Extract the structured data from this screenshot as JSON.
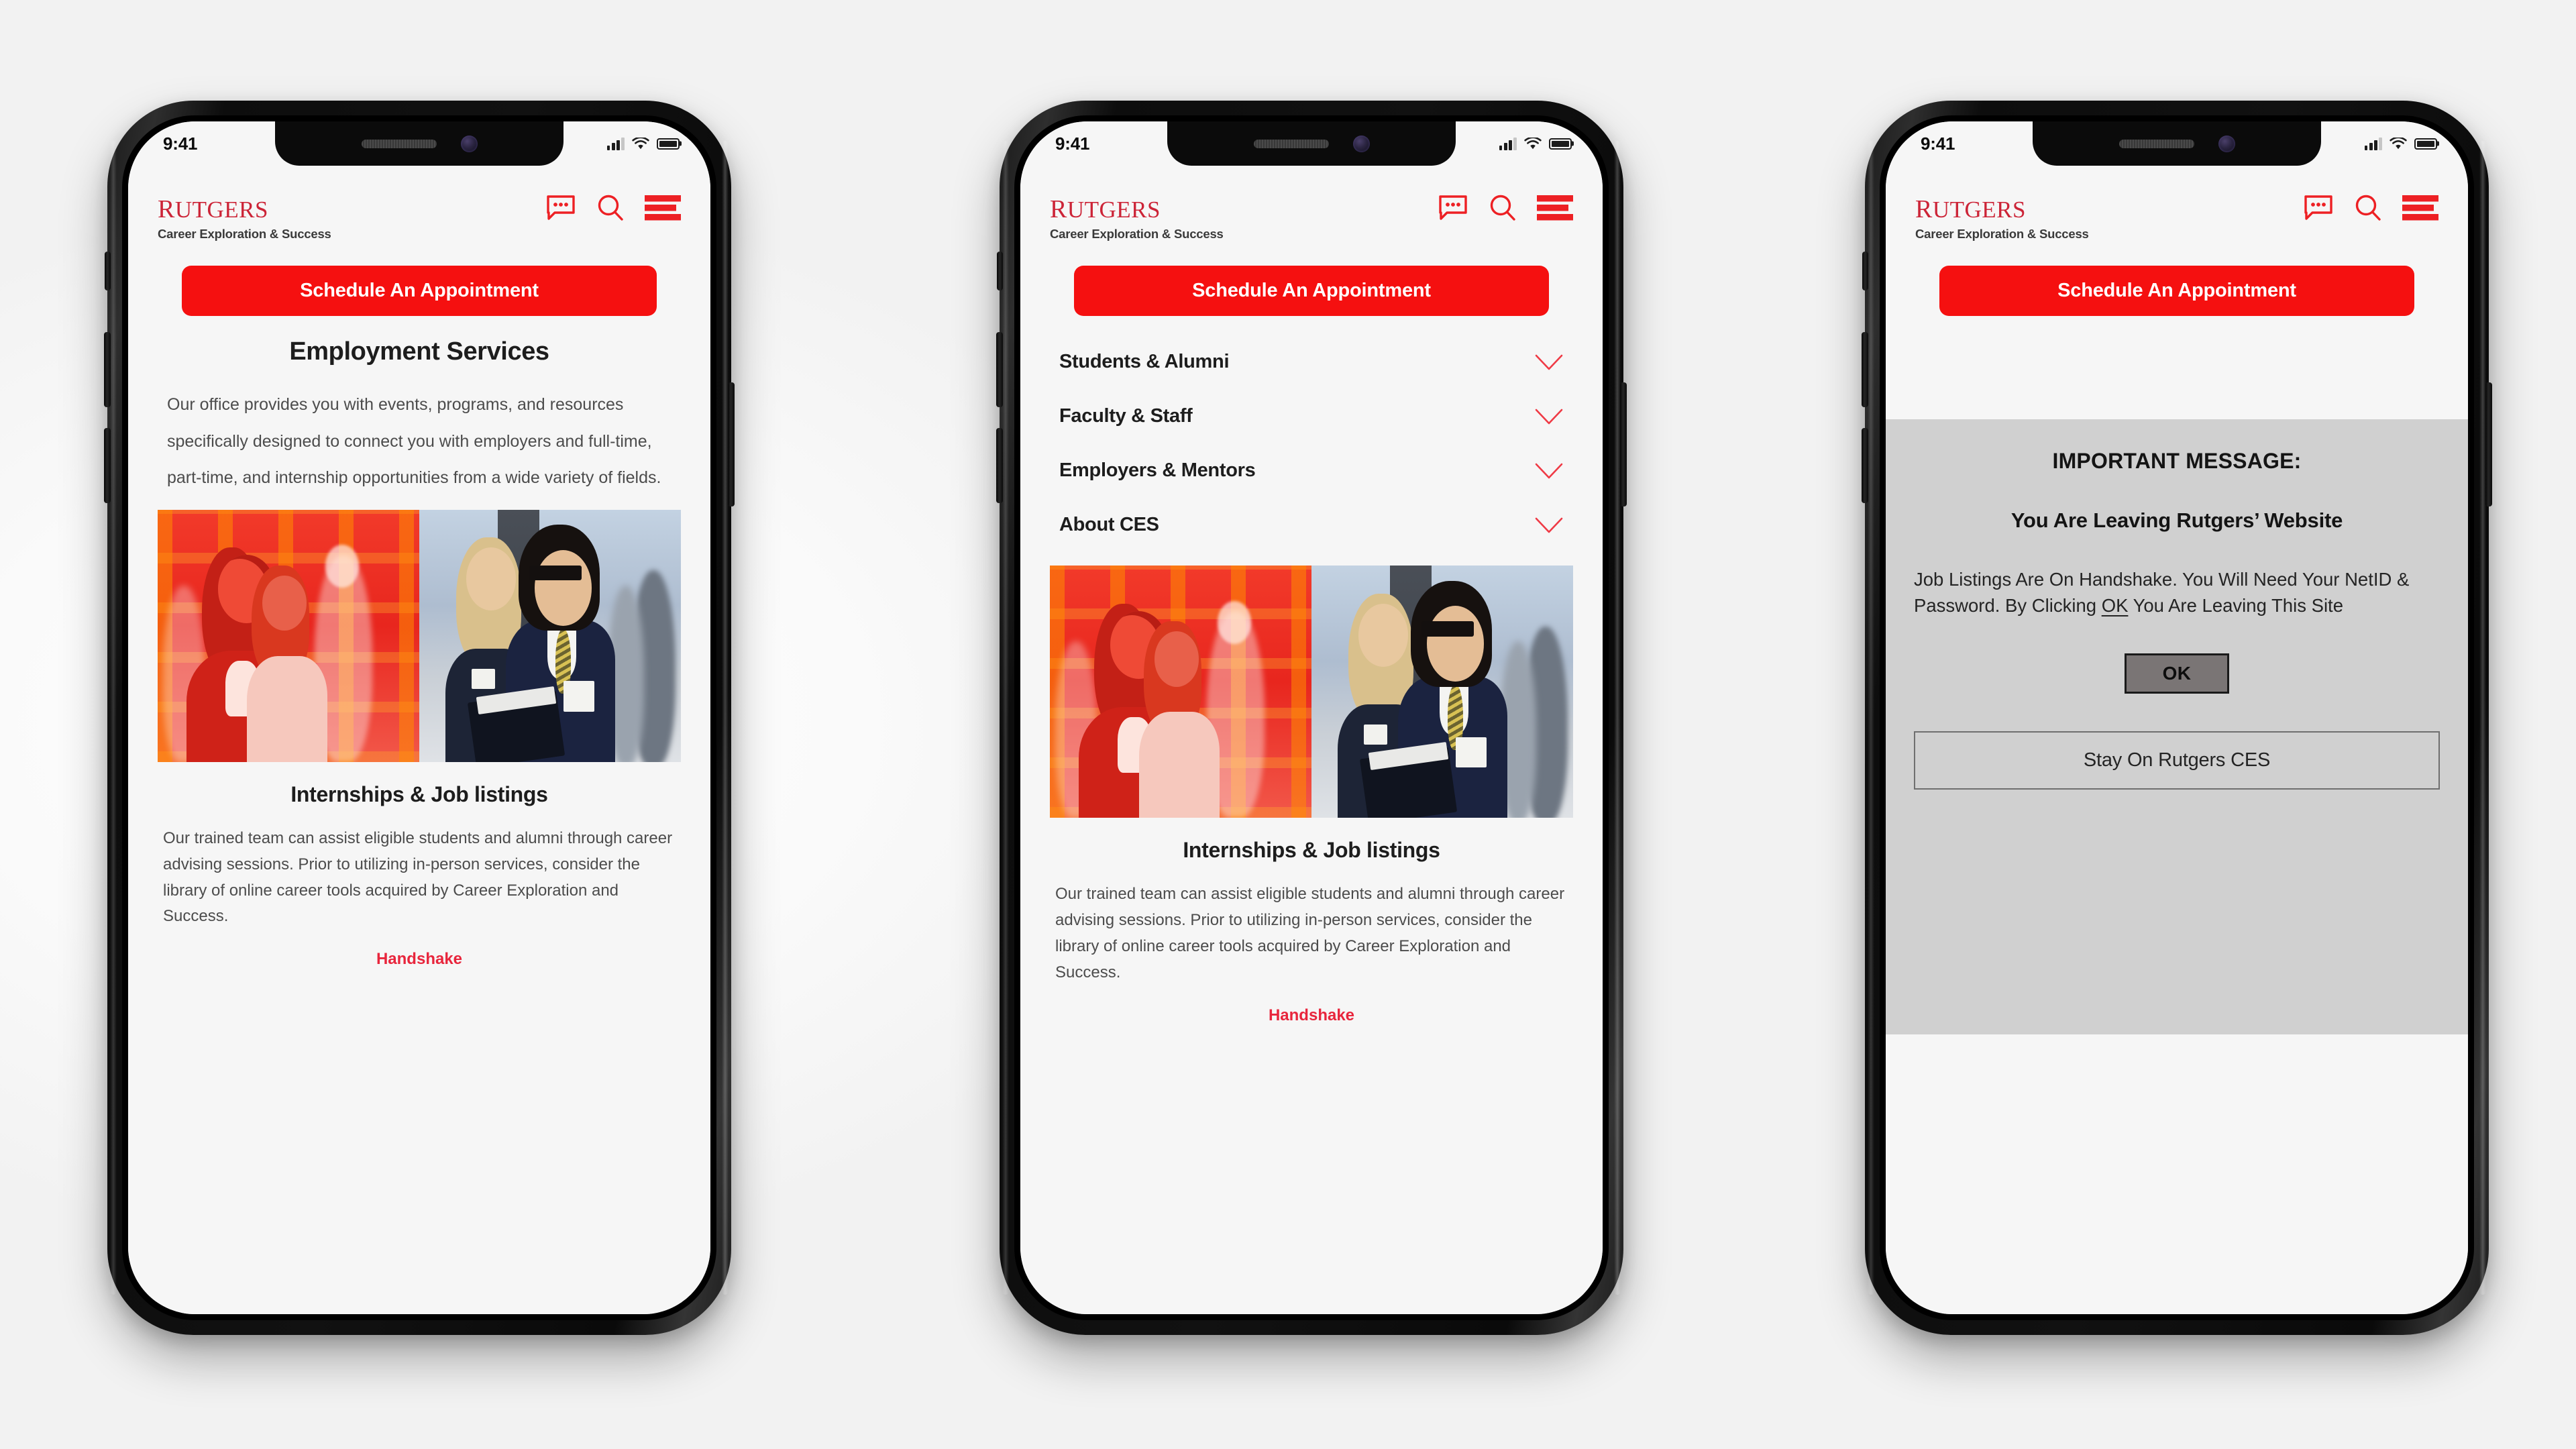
{
  "status_bar": {
    "time": "9:41",
    "signal_icon": "cellular-bars-icon",
    "wifi_icon": "wifi-icon",
    "battery_icon": "battery-icon"
  },
  "header": {
    "wordmark": "Rutgers",
    "tagline": "Career Exploration & Success",
    "icons": [
      {
        "name": "chat-icon",
        "label": "Chat"
      },
      {
        "name": "search-icon",
        "label": "Search"
      },
      {
        "name": "hamburger-menu-icon",
        "label": "Menu"
      }
    ]
  },
  "cta": {
    "label": "Schedule An Appointment"
  },
  "screen1": {
    "title": "Employment Services",
    "body": "Our office provides you with events, programs, and resources specifically designed to connect you with employers and full-time, part-time, and internship opportunities from a wide variety of fields."
  },
  "nav": {
    "items": [
      {
        "label": "Students & Alumni",
        "chevron": "chevron-down-icon"
      },
      {
        "label": "Faculty & Staff",
        "chevron": "chevron-down-icon"
      },
      {
        "label": "Employers & Mentors",
        "chevron": "chevron-down-icon"
      },
      {
        "label": "About CES",
        "chevron": "chevron-down-icon"
      }
    ]
  },
  "photo": {
    "alt": "Students networking with employers at a career fair"
  },
  "card": {
    "title": "Internships & Job listings",
    "body": "Our trained team can assist eligible students and alumni through career advising sessions. Prior to utilizing in-person services, consider the library of online career tools acquired by Career Exploration and Success.",
    "link": "Handshake"
  },
  "modal": {
    "kicker": "IMPORTANT MESSAGE:",
    "heading": "You Are Leaving Rutgers’ Website",
    "body_part1": "Job Listings Are On Handshake. You Will Need Your NetID & Password. By Clicking ",
    "body_emphasis": "OK",
    "body_part2": " You Are Leaving This Site",
    "ok_label": "OK",
    "stay_label": "Stay On Rutgers CES"
  },
  "colors": {
    "brand_red": "#cc2437",
    "cta_red": "#f51010",
    "link_red": "#e8253c",
    "modal_backdrop": "#d0d0d0",
    "ok_button": "#7a7575"
  }
}
